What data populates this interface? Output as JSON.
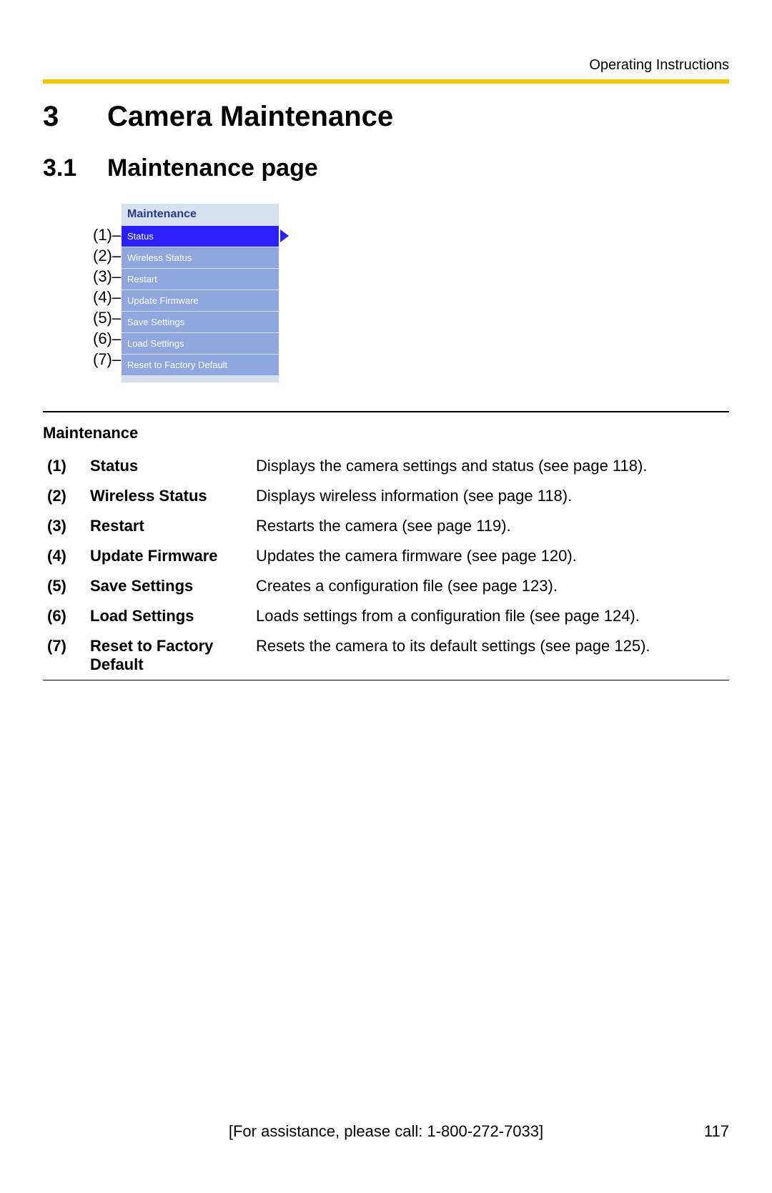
{
  "header_label": "Operating Instructions",
  "chapter": {
    "num": "3",
    "title": "Camera Maintenance"
  },
  "section": {
    "num": "3.1",
    "title": "Maintenance page"
  },
  "menu_title": "Maintenance",
  "menu_items": [
    {
      "callout": "(1)",
      "label": "Status",
      "selected": true
    },
    {
      "callout": "(2)",
      "label": "Wireless Status",
      "selected": false
    },
    {
      "callout": "(3)",
      "label": "Restart",
      "selected": false
    },
    {
      "callout": "(4)",
      "label": "Update Firmware",
      "selected": false
    },
    {
      "callout": "(5)",
      "label": "Save Settings",
      "selected": false
    },
    {
      "callout": "(6)",
      "label": "Load Settings",
      "selected": false
    },
    {
      "callout": "(7)",
      "label": "Reset to Factory Default",
      "selected": false
    }
  ],
  "desc_title": "Maintenance",
  "descriptions": [
    {
      "num": "(1)",
      "name": "Status",
      "text": "Displays the camera settings and status (see page 118)."
    },
    {
      "num": "(2)",
      "name": "Wireless Status",
      "text": "Displays wireless information (see page 118)."
    },
    {
      "num": "(3)",
      "name": "Restart",
      "text": "Restarts the camera (see page 119)."
    },
    {
      "num": "(4)",
      "name": "Update Firmware",
      "text": "Updates the camera firmware (see page 120)."
    },
    {
      "num": "(5)",
      "name": "Save Settings",
      "text": "Creates a configuration file (see page 123)."
    },
    {
      "num": "(6)",
      "name": "Load Settings",
      "text": "Loads settings from a configuration file (see page 124)."
    },
    {
      "num": "(7)",
      "name": "Reset to Factory Default",
      "text": "Resets the camera to its default settings (see page 125)."
    }
  ],
  "footer": {
    "assist": "[For assistance, please call: 1-800-272-7033]",
    "page": "117"
  }
}
